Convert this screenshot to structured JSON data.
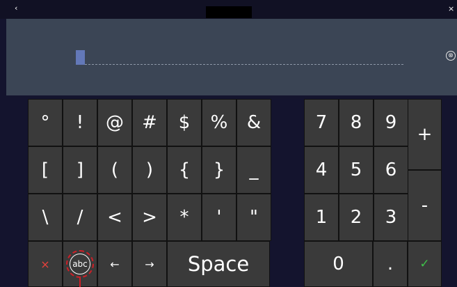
{
  "topbar": {
    "back_label": "‹",
    "close_label": "×"
  },
  "input": {
    "clear_icon": "⊗"
  },
  "symbols": [
    [
      "°",
      "!",
      "@",
      "#",
      "$",
      "%",
      "&"
    ],
    [
      "[",
      "]",
      "(",
      ")",
      "{",
      "}",
      "_"
    ],
    [
      "\\",
      "/",
      "<",
      ">",
      "*",
      "'",
      "\""
    ]
  ],
  "bottom_row": {
    "cancel": "×",
    "abc": "abc",
    "left": "←",
    "right": "→",
    "space": "Space"
  },
  "numpad": {
    "rows": [
      [
        "7",
        "8",
        "9"
      ],
      [
        "4",
        "5",
        "6"
      ],
      [
        "1",
        "2",
        "3"
      ]
    ],
    "zero": "0",
    "dot": ".",
    "plus": "+",
    "minus": "-",
    "enter": "✓"
  },
  "colors": {
    "cancel": "#e8413c",
    "enter": "#3fc24a",
    "highlight": "#d01e26"
  }
}
